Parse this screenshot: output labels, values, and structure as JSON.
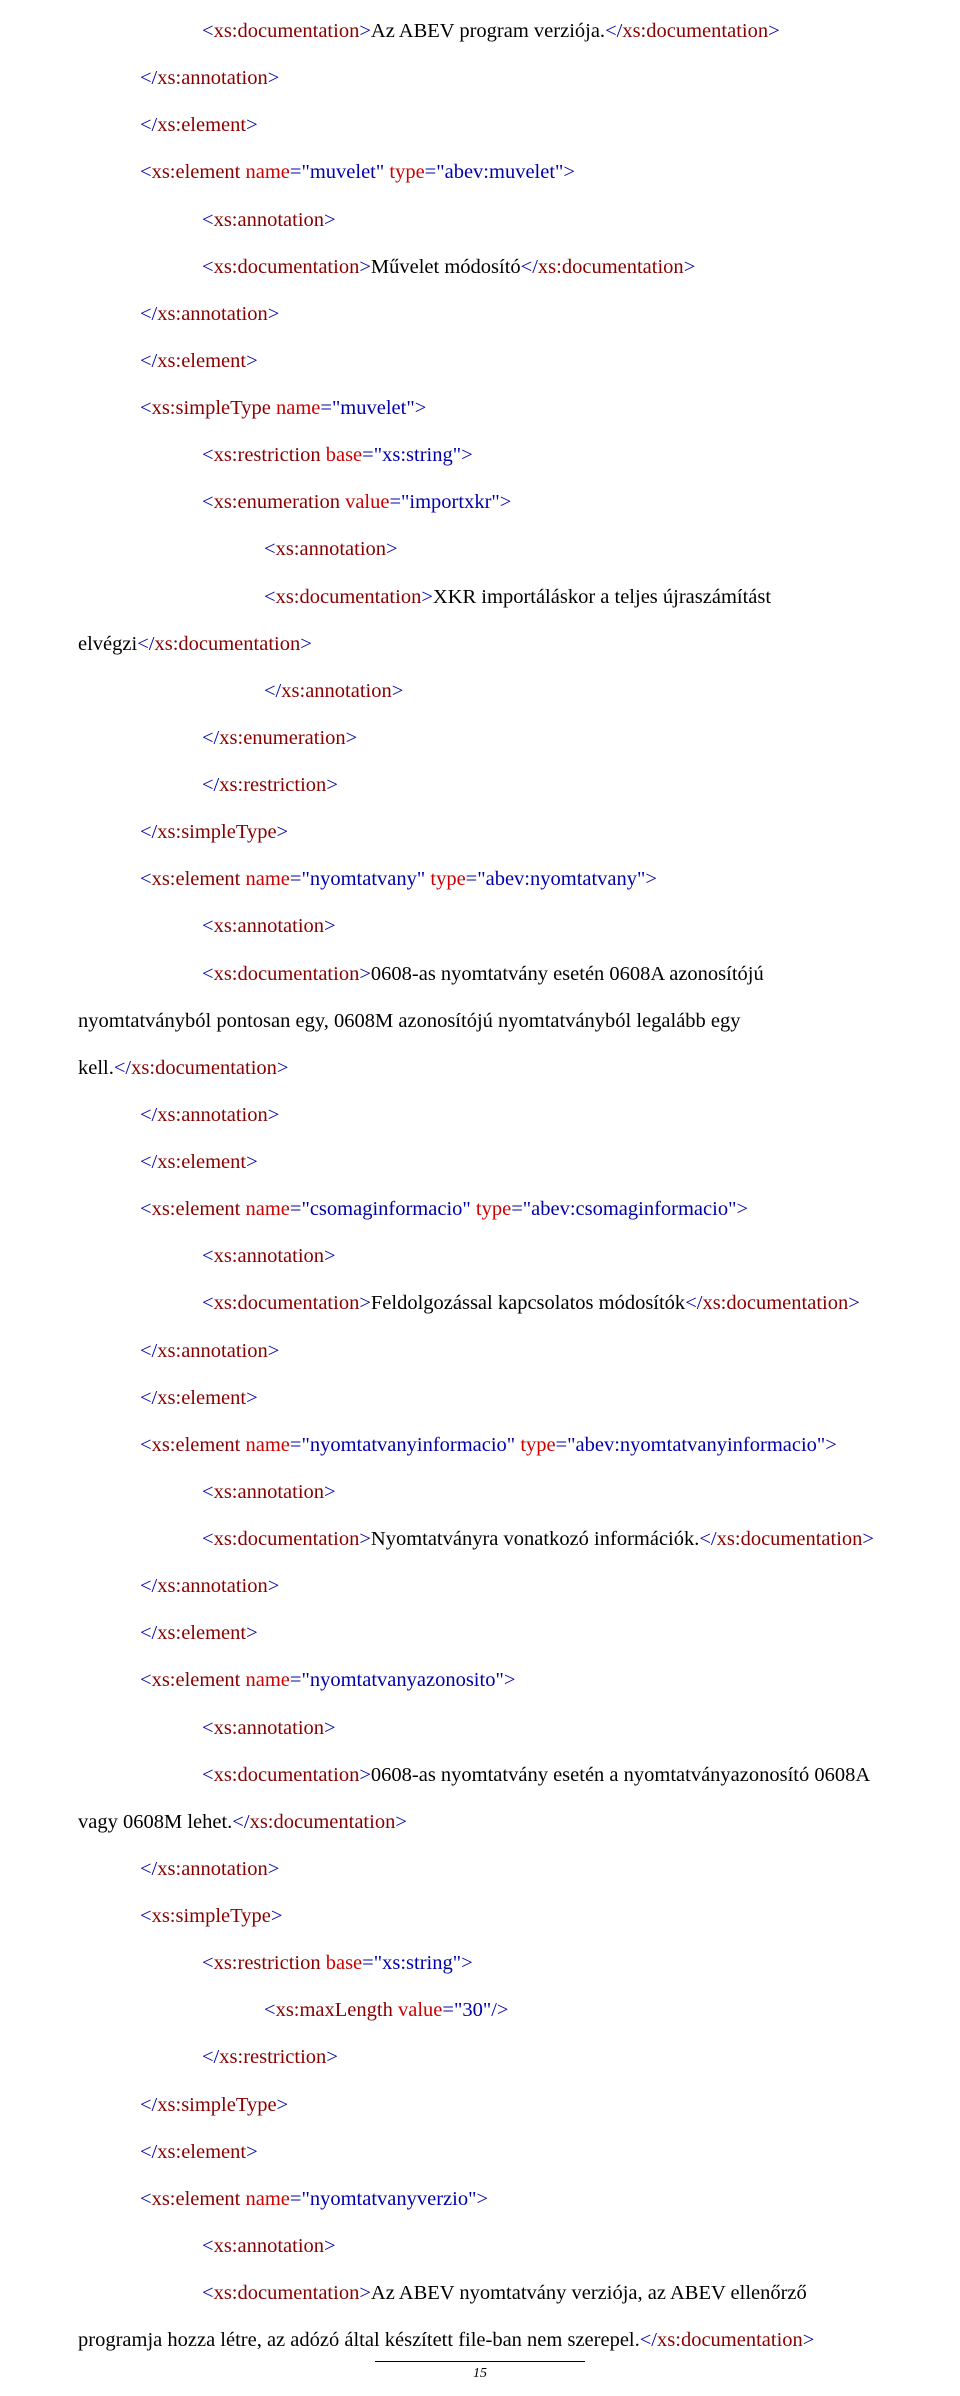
{
  "lines": [
    {
      "indent": "i2",
      "tokens": [
        [
          "br",
          "<"
        ],
        [
          "tag",
          "xs:documentation"
        ],
        [
          "br",
          ">"
        ],
        [
          "txt",
          "Az ABEV program verziója."
        ],
        [
          "br",
          "</"
        ],
        [
          "tag",
          "xs:documentation"
        ],
        [
          "br",
          ">"
        ]
      ]
    },
    {
      "indent": "i1",
      "tokens": [
        [
          "br",
          "</"
        ],
        [
          "tag",
          "xs:annotation"
        ],
        [
          "br",
          ">"
        ]
      ]
    },
    {
      "indent": "i1",
      "tokens": [
        [
          "br",
          "</"
        ],
        [
          "tag",
          "xs:element"
        ],
        [
          "br",
          ">"
        ]
      ]
    },
    {
      "indent": "i1",
      "tokens": [
        [
          "br",
          "<"
        ],
        [
          "tag",
          "xs:element"
        ],
        [
          "txt",
          " "
        ],
        [
          "att",
          "name"
        ],
        [
          "eq",
          "="
        ],
        [
          "val",
          "\"muvelet\""
        ],
        [
          "txt",
          " "
        ],
        [
          "att",
          "type"
        ],
        [
          "eq",
          "="
        ],
        [
          "val",
          "\"abev:muvelet\""
        ],
        [
          "br",
          ">"
        ]
      ]
    },
    {
      "indent": "i2",
      "tokens": [
        [
          "br",
          "<"
        ],
        [
          "tag",
          "xs:annotation"
        ],
        [
          "br",
          ">"
        ]
      ]
    },
    {
      "indent": "i2",
      "tokens": [
        [
          "br",
          "<"
        ],
        [
          "tag",
          "xs:documentation"
        ],
        [
          "br",
          ">"
        ],
        [
          "txt",
          "Művelet módosító"
        ],
        [
          "br",
          "</"
        ],
        [
          "tag",
          "xs:documentation"
        ],
        [
          "br",
          ">"
        ]
      ]
    },
    {
      "indent": "i1",
      "tokens": [
        [
          "br",
          "</"
        ],
        [
          "tag",
          "xs:annotation"
        ],
        [
          "br",
          ">"
        ]
      ]
    },
    {
      "indent": "i1",
      "tokens": [
        [
          "br",
          "</"
        ],
        [
          "tag",
          "xs:element"
        ],
        [
          "br",
          ">"
        ]
      ]
    },
    {
      "indent": "i1",
      "tokens": [
        [
          "br",
          "<"
        ],
        [
          "tag",
          "xs:simpleType"
        ],
        [
          "txt",
          " "
        ],
        [
          "att",
          "name"
        ],
        [
          "eq",
          "="
        ],
        [
          "val",
          "\"muvelet\""
        ],
        [
          "br",
          ">"
        ]
      ]
    },
    {
      "indent": "i2",
      "tokens": [
        [
          "br",
          "<"
        ],
        [
          "tag",
          "xs:restriction"
        ],
        [
          "txt",
          " "
        ],
        [
          "att",
          "base"
        ],
        [
          "eq",
          "="
        ],
        [
          "val",
          "\"xs:string\""
        ],
        [
          "br",
          ">"
        ]
      ]
    },
    {
      "indent": "i2",
      "tokens": [
        [
          "br",
          "<"
        ],
        [
          "tag",
          "xs:enumeration"
        ],
        [
          "txt",
          " "
        ],
        [
          "att",
          "value"
        ],
        [
          "eq",
          "="
        ],
        [
          "val",
          "\"importxkr\""
        ],
        [
          "br",
          ">"
        ]
      ]
    },
    {
      "indent": "i3",
      "tokens": [
        [
          "br",
          "<"
        ],
        [
          "tag",
          "xs:annotation"
        ],
        [
          "br",
          ">"
        ]
      ]
    },
    {
      "indent": "i3",
      "tokens": [
        [
          "br",
          "<"
        ],
        [
          "tag",
          "xs:documentation"
        ],
        [
          "br",
          ">"
        ],
        [
          "txt",
          "XKR importáláskor a teljes újraszámítást"
        ]
      ]
    },
    {
      "indent": "no",
      "tokens": [
        [
          "txt",
          "elvégzi"
        ],
        [
          "br",
          "</"
        ],
        [
          "tag",
          "xs:documentation"
        ],
        [
          "br",
          ">"
        ]
      ]
    },
    {
      "indent": "i3",
      "tokens": [
        [
          "br",
          "</"
        ],
        [
          "tag",
          "xs:annotation"
        ],
        [
          "br",
          ">"
        ]
      ]
    },
    {
      "indent": "i2",
      "tokens": [
        [
          "br",
          "</"
        ],
        [
          "tag",
          "xs:enumeration"
        ],
        [
          "br",
          ">"
        ]
      ]
    },
    {
      "indent": "i2",
      "tokens": [
        [
          "br",
          "</"
        ],
        [
          "tag",
          "xs:restriction"
        ],
        [
          "br",
          ">"
        ]
      ]
    },
    {
      "indent": "i1",
      "tokens": [
        [
          "br",
          "</"
        ],
        [
          "tag",
          "xs:simpleType"
        ],
        [
          "br",
          ">"
        ]
      ]
    },
    {
      "indent": "i1",
      "tokens": [
        [
          "br",
          "<"
        ],
        [
          "tag",
          "xs:element"
        ],
        [
          "txt",
          " "
        ],
        [
          "att",
          "name"
        ],
        [
          "eq",
          "="
        ],
        [
          "val",
          "\"nyomtatvany\""
        ],
        [
          "txt",
          " "
        ],
        [
          "att",
          "type"
        ],
        [
          "eq",
          "="
        ],
        [
          "val",
          "\"abev:nyomtatvany\""
        ],
        [
          "br",
          ">"
        ]
      ]
    },
    {
      "indent": "i2",
      "tokens": [
        [
          "br",
          "<"
        ],
        [
          "tag",
          "xs:annotation"
        ],
        [
          "br",
          ">"
        ]
      ]
    },
    {
      "indent": "i2",
      "tokens": [
        [
          "br",
          "<"
        ],
        [
          "tag",
          "xs:documentation"
        ],
        [
          "br",
          ">"
        ],
        [
          "txt",
          "0608-as nyomtatvány esetén 0608A azonosítójú"
        ]
      ]
    },
    {
      "indent": "no",
      "tokens": [
        [
          "txt",
          "nyomtatványból pontosan egy, 0608M azonosítójú nyomtatványból legalább egy"
        ]
      ]
    },
    {
      "indent": "no",
      "tokens": [
        [
          "txt",
          "kell."
        ],
        [
          "br",
          "</"
        ],
        [
          "tag",
          "xs:documentation"
        ],
        [
          "br",
          ">"
        ]
      ]
    },
    {
      "indent": "i1",
      "tokens": [
        [
          "br",
          "</"
        ],
        [
          "tag",
          "xs:annotation"
        ],
        [
          "br",
          ">"
        ]
      ]
    },
    {
      "indent": "i1",
      "tokens": [
        [
          "br",
          "</"
        ],
        [
          "tag",
          "xs:element"
        ],
        [
          "br",
          ">"
        ]
      ]
    },
    {
      "indent": "i1",
      "tokens": [
        [
          "br",
          "<"
        ],
        [
          "tag",
          "xs:element"
        ],
        [
          "txt",
          " "
        ],
        [
          "att",
          "name"
        ],
        [
          "eq",
          "="
        ],
        [
          "val",
          "\"csomaginformacio\""
        ],
        [
          "txt",
          " "
        ],
        [
          "att",
          "type"
        ],
        [
          "eq",
          "="
        ],
        [
          "val",
          "\"abev:csomaginformacio\""
        ],
        [
          "br",
          ">"
        ]
      ]
    },
    {
      "indent": "i2",
      "tokens": [
        [
          "br",
          "<"
        ],
        [
          "tag",
          "xs:annotation"
        ],
        [
          "br",
          ">"
        ]
      ]
    },
    {
      "indent": "i2",
      "tokens": [
        [
          "br",
          "<"
        ],
        [
          "tag",
          "xs:documentation"
        ],
        [
          "br",
          ">"
        ],
        [
          "txt",
          "Feldolgozással kapcsolatos módosítók"
        ],
        [
          "br",
          "</"
        ],
        [
          "tag",
          "xs:documentation"
        ],
        [
          "br",
          ">"
        ]
      ]
    },
    {
      "indent": "i1",
      "tokens": [
        [
          "br",
          "</"
        ],
        [
          "tag",
          "xs:annotation"
        ],
        [
          "br",
          ">"
        ]
      ]
    },
    {
      "indent": "i1",
      "tokens": [
        [
          "br",
          "</"
        ],
        [
          "tag",
          "xs:element"
        ],
        [
          "br",
          ">"
        ]
      ]
    },
    {
      "indent": "i1",
      "tokens": [
        [
          "br",
          "<"
        ],
        [
          "tag",
          "xs:element"
        ],
        [
          "txt",
          " "
        ],
        [
          "att",
          "name"
        ],
        [
          "eq",
          "="
        ],
        [
          "val",
          "\"nyomtatvanyinformacio\""
        ],
        [
          "txt",
          " "
        ],
        [
          "att",
          "type"
        ],
        [
          "eq",
          "="
        ],
        [
          "val",
          "\"abev:nyomtatvanyinformacio\""
        ],
        [
          "br",
          ">"
        ]
      ]
    },
    {
      "indent": "i2",
      "tokens": [
        [
          "br",
          "<"
        ],
        [
          "tag",
          "xs:annotation"
        ],
        [
          "br",
          ">"
        ]
      ]
    },
    {
      "indent": "i2",
      "tokens": [
        [
          "br",
          "<"
        ],
        [
          "tag",
          "xs:documentation"
        ],
        [
          "br",
          ">"
        ],
        [
          "txt",
          "Nyomtatványra vonatkozó információk."
        ],
        [
          "br",
          "</"
        ],
        [
          "tag",
          "xs:documentation"
        ],
        [
          "br",
          ">"
        ]
      ]
    },
    {
      "indent": "i1",
      "tokens": [
        [
          "br",
          "</"
        ],
        [
          "tag",
          "xs:annotation"
        ],
        [
          "br",
          ">"
        ]
      ]
    },
    {
      "indent": "i1",
      "tokens": [
        [
          "br",
          "</"
        ],
        [
          "tag",
          "xs:element"
        ],
        [
          "br",
          ">"
        ]
      ]
    },
    {
      "indent": "i1",
      "tokens": [
        [
          "br",
          "<"
        ],
        [
          "tag",
          "xs:element"
        ],
        [
          "txt",
          " "
        ],
        [
          "att",
          "name"
        ],
        [
          "eq",
          "="
        ],
        [
          "val",
          "\"nyomtatvanyazonosito\""
        ],
        [
          "br",
          ">"
        ]
      ]
    },
    {
      "indent": "i2",
      "tokens": [
        [
          "br",
          "<"
        ],
        [
          "tag",
          "xs:annotation"
        ],
        [
          "br",
          ">"
        ]
      ]
    },
    {
      "indent": "i2",
      "tokens": [
        [
          "br",
          "<"
        ],
        [
          "tag",
          "xs:documentation"
        ],
        [
          "br",
          ">"
        ],
        [
          "txt",
          "0608-as nyomtatvány esetén a nyomtatványazonosító 0608A"
        ]
      ]
    },
    {
      "indent": "no",
      "tokens": [
        [
          "txt",
          "vagy 0608M lehet."
        ],
        [
          "br",
          "</"
        ],
        [
          "tag",
          "xs:documentation"
        ],
        [
          "br",
          ">"
        ]
      ]
    },
    {
      "indent": "i1",
      "tokens": [
        [
          "br",
          "</"
        ],
        [
          "tag",
          "xs:annotation"
        ],
        [
          "br",
          ">"
        ]
      ]
    },
    {
      "indent": "i1",
      "tokens": [
        [
          "br",
          "<"
        ],
        [
          "tag",
          "xs:simpleType"
        ],
        [
          "br",
          ">"
        ]
      ]
    },
    {
      "indent": "i2",
      "tokens": [
        [
          "br",
          "<"
        ],
        [
          "tag",
          "xs:restriction"
        ],
        [
          "txt",
          " "
        ],
        [
          "att",
          "base"
        ],
        [
          "eq",
          "="
        ],
        [
          "val",
          "\"xs:string\""
        ],
        [
          "br",
          ">"
        ]
      ]
    },
    {
      "indent": "i3",
      "tokens": [
        [
          "br",
          "<"
        ],
        [
          "tag",
          "xs:maxLength"
        ],
        [
          "txt",
          " "
        ],
        [
          "att",
          "value"
        ],
        [
          "eq",
          "="
        ],
        [
          "val",
          "\"30\""
        ],
        [
          "br",
          "/>"
        ]
      ]
    },
    {
      "indent": "i2",
      "tokens": [
        [
          "br",
          "</"
        ],
        [
          "tag",
          "xs:restriction"
        ],
        [
          "br",
          ">"
        ]
      ]
    },
    {
      "indent": "i1",
      "tokens": [
        [
          "br",
          "</"
        ],
        [
          "tag",
          "xs:simpleType"
        ],
        [
          "br",
          ">"
        ]
      ]
    },
    {
      "indent": "i1",
      "tokens": [
        [
          "br",
          "</"
        ],
        [
          "tag",
          "xs:element"
        ],
        [
          "br",
          ">"
        ]
      ]
    },
    {
      "indent": "i1",
      "tokens": [
        [
          "br",
          "<"
        ],
        [
          "tag",
          "xs:element"
        ],
        [
          "txt",
          " "
        ],
        [
          "att",
          "name"
        ],
        [
          "eq",
          "="
        ],
        [
          "val",
          "\"nyomtatvanyverzio\""
        ],
        [
          "br",
          ">"
        ]
      ]
    },
    {
      "indent": "i2",
      "tokens": [
        [
          "br",
          "<"
        ],
        [
          "tag",
          "xs:annotation"
        ],
        [
          "br",
          ">"
        ]
      ]
    },
    {
      "indent": "i2",
      "tokens": [
        [
          "br",
          "<"
        ],
        [
          "tag",
          "xs:documentation"
        ],
        [
          "br",
          ">"
        ],
        [
          "txt",
          "Az ABEV nyomtatvány verziója, az ABEV ellenőrző"
        ]
      ]
    },
    {
      "indent": "no",
      "tokens": [
        [
          "txt",
          "programja hozza létre, az adózó által készített file-ban nem szerepel."
        ],
        [
          "br",
          "</"
        ],
        [
          "tag",
          "xs:documentation"
        ],
        [
          "br",
          ">"
        ]
      ]
    }
  ],
  "page_number": "15"
}
